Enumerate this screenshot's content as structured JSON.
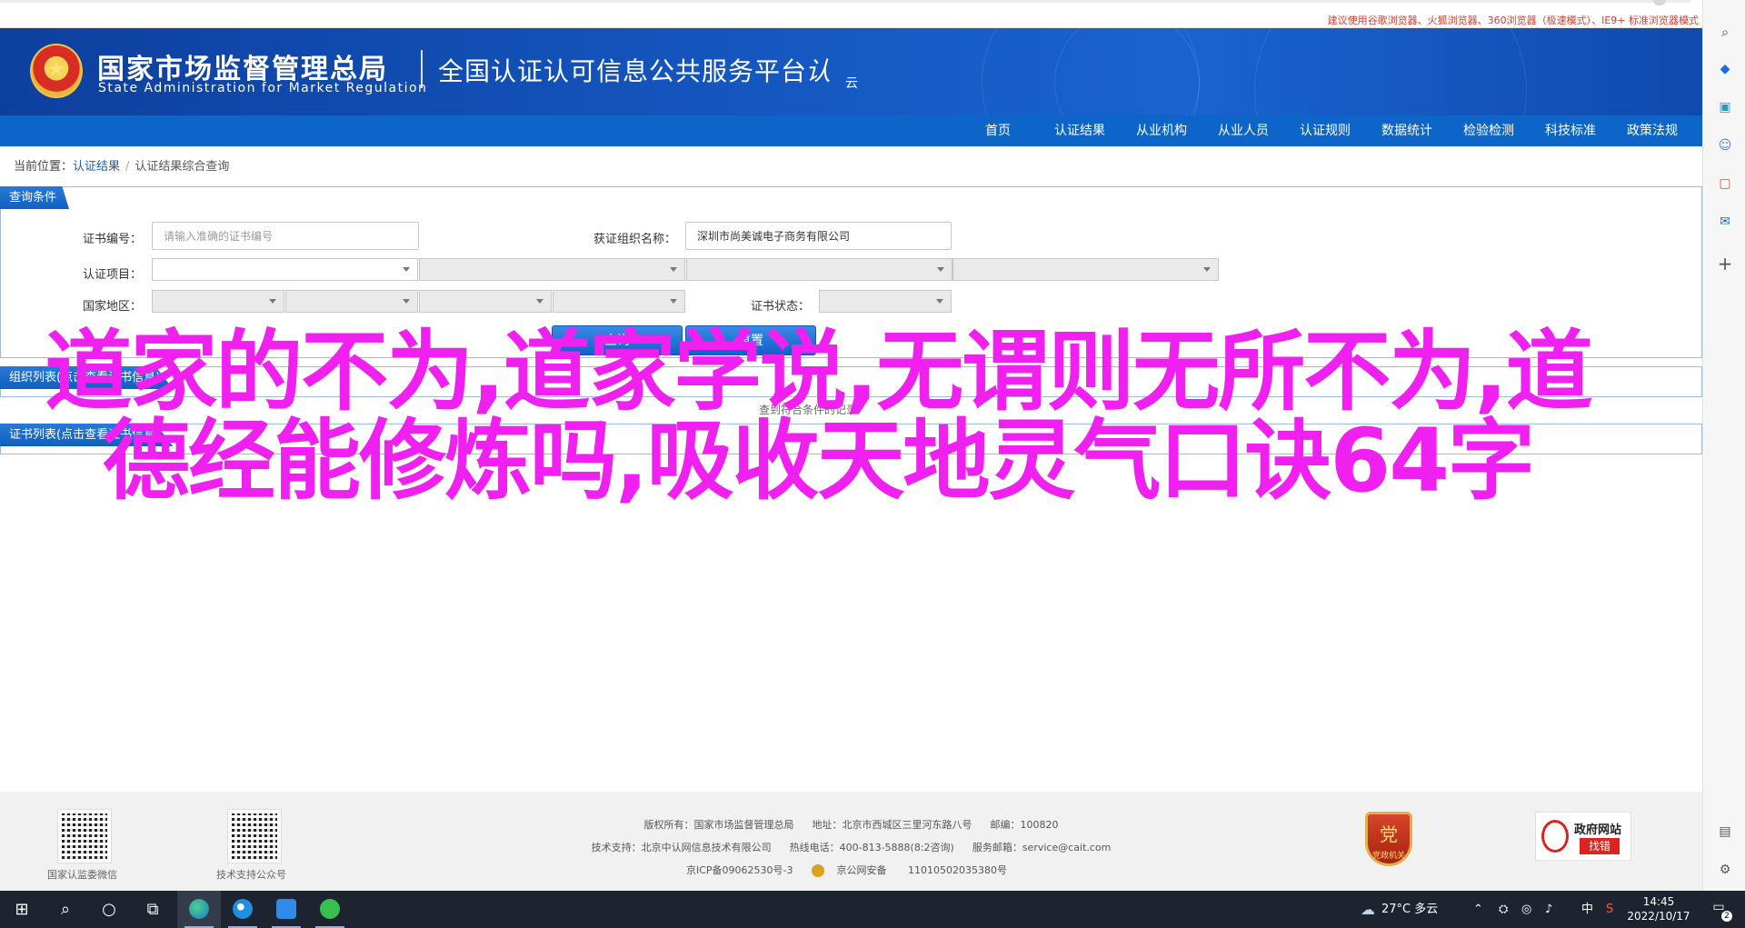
{
  "browser_notice": "建议使用谷歌浏览器、火狐浏览器、360浏览器（极速模式）、IE9+ 标准浏览器模式",
  "header": {
    "agency_cn": "国家市场监督管理总局",
    "agency_en": "State Administration  for  Market Regulation",
    "platform_name": "全国认证认可信息公共服务平台",
    "platform_logo": "认",
    "platform_logo_sub": "云"
  },
  "nav": {
    "items": [
      "首页",
      "认证结果",
      "从业机构",
      "从业人员",
      "认证规则",
      "数据统计",
      "检验检测",
      "科技标准",
      "政策法规"
    ]
  },
  "breadcrumb": {
    "prefix": "当前位置：",
    "link": "认证结果",
    "separator": "/",
    "current": "认证结果综合查询"
  },
  "query_panel": {
    "title": "查询条件",
    "cert_no_label": "证书编号：",
    "cert_no_placeholder": "请输入准确的证书编号",
    "org_name_label": "获证组织名称：",
    "org_name_value": "深圳市尚美诚电子商务有限公司",
    "cert_item_label": "认证项目：",
    "region_label": "国家地区：",
    "cert_status_label": "证书状态：",
    "btn_query": "查询",
    "btn_reset": "重置"
  },
  "org_panel": {
    "title": "组织列表(点击查看证书信息)",
    "summary": "查到符合条件的记录"
  },
  "cert_panel": {
    "title": "证书列表(点击查看证书信息)"
  },
  "overlay_text": "道家的不为,道家学说,无谓则无所不为,道德经能修炼吗,吸收天地灵气口诀64字",
  "footer": {
    "qr1_label": "国家认监委微信",
    "qr2_label": "技术支持公众号",
    "line1": {
      "copyright": "版权所有：国家市场监督管理总局",
      "address": "地址：北京市西城区三里河东路八号",
      "postcode": "邮编：100820"
    },
    "line2": {
      "support": "技术支持：北京中认网信息技术有限公司",
      "hotline": "热线电话：400-813-5888(8:2咨询)",
      "email": "服务邮箱：service@cait.com"
    },
    "line3": {
      "icp": "京ICP备09062530号-3",
      "police": "京公网安备",
      "police_no": "11010502035380号"
    },
    "party_badge": "党政机关",
    "gov_badge_title": "政府网站",
    "gov_badge_action": "找错"
  },
  "taskbar": {
    "weather": "27°C  多云",
    "ime": "中",
    "time": "14:45",
    "date": "2022/10/17",
    "notification_count": "2"
  },
  "colors": {
    "header_blue": "#1557c0",
    "nav_blue": "#0d65c9",
    "overlay_pink": "#f020f0",
    "notice_red": "#e23b2b"
  }
}
